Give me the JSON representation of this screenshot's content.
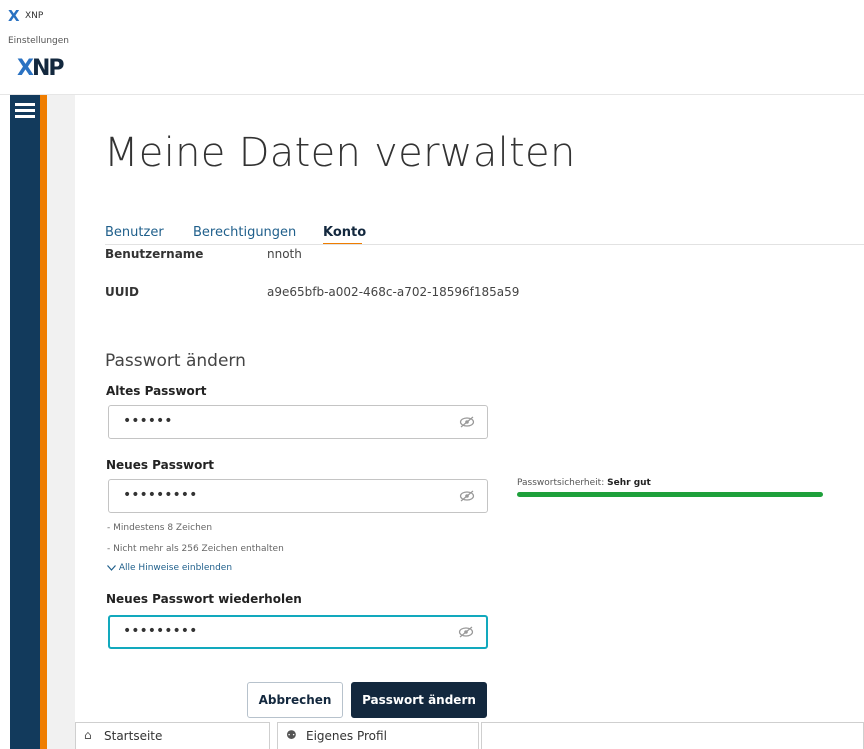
{
  "app": {
    "title": "XNP",
    "subtitle": "Einstellungen",
    "logo_letters": "XNP",
    "accent_color": "#ef7d00",
    "brand_color": "#13283e"
  },
  "page": {
    "title": "Meine Daten verwalten"
  },
  "tabs": [
    {
      "label": "Benutzer",
      "active": false
    },
    {
      "label": "Berechtigungen",
      "active": false
    },
    {
      "label": "Konto",
      "active": true
    }
  ],
  "account": {
    "username_label": "Benutzername",
    "username_value": "nnoth",
    "uuid_label": "UUID",
    "uuid_value": "a9e65bfb-a002-468c-a702-18596f185a59"
  },
  "password": {
    "section_title": "Passwort ändern",
    "old_label": "Altes Passwort",
    "old_value": "••••••",
    "new_label": "Neues Passwort",
    "new_value": "•••••••••",
    "repeat_label": "Neues Passwort wiederholen",
    "repeat_value": "•••••••••",
    "strength_label": "Passwortsicherheit:",
    "strength_value": "Sehr gut",
    "strength_level": 1.0,
    "strength_color": "#1ea03b",
    "hints": [
      "- Mindestens 8 Zeichen",
      "- Nicht mehr als 256 Zeichen enthalten"
    ],
    "show_hints_label": "Alle Hinweise einblenden",
    "cancel_label": "Abbrechen",
    "submit_label": "Passwort ändern"
  },
  "footer_tabs": [
    {
      "label": "Startseite",
      "icon": "home-icon"
    },
    {
      "label": "Eigenes Profil",
      "icon": "users-icon"
    }
  ]
}
